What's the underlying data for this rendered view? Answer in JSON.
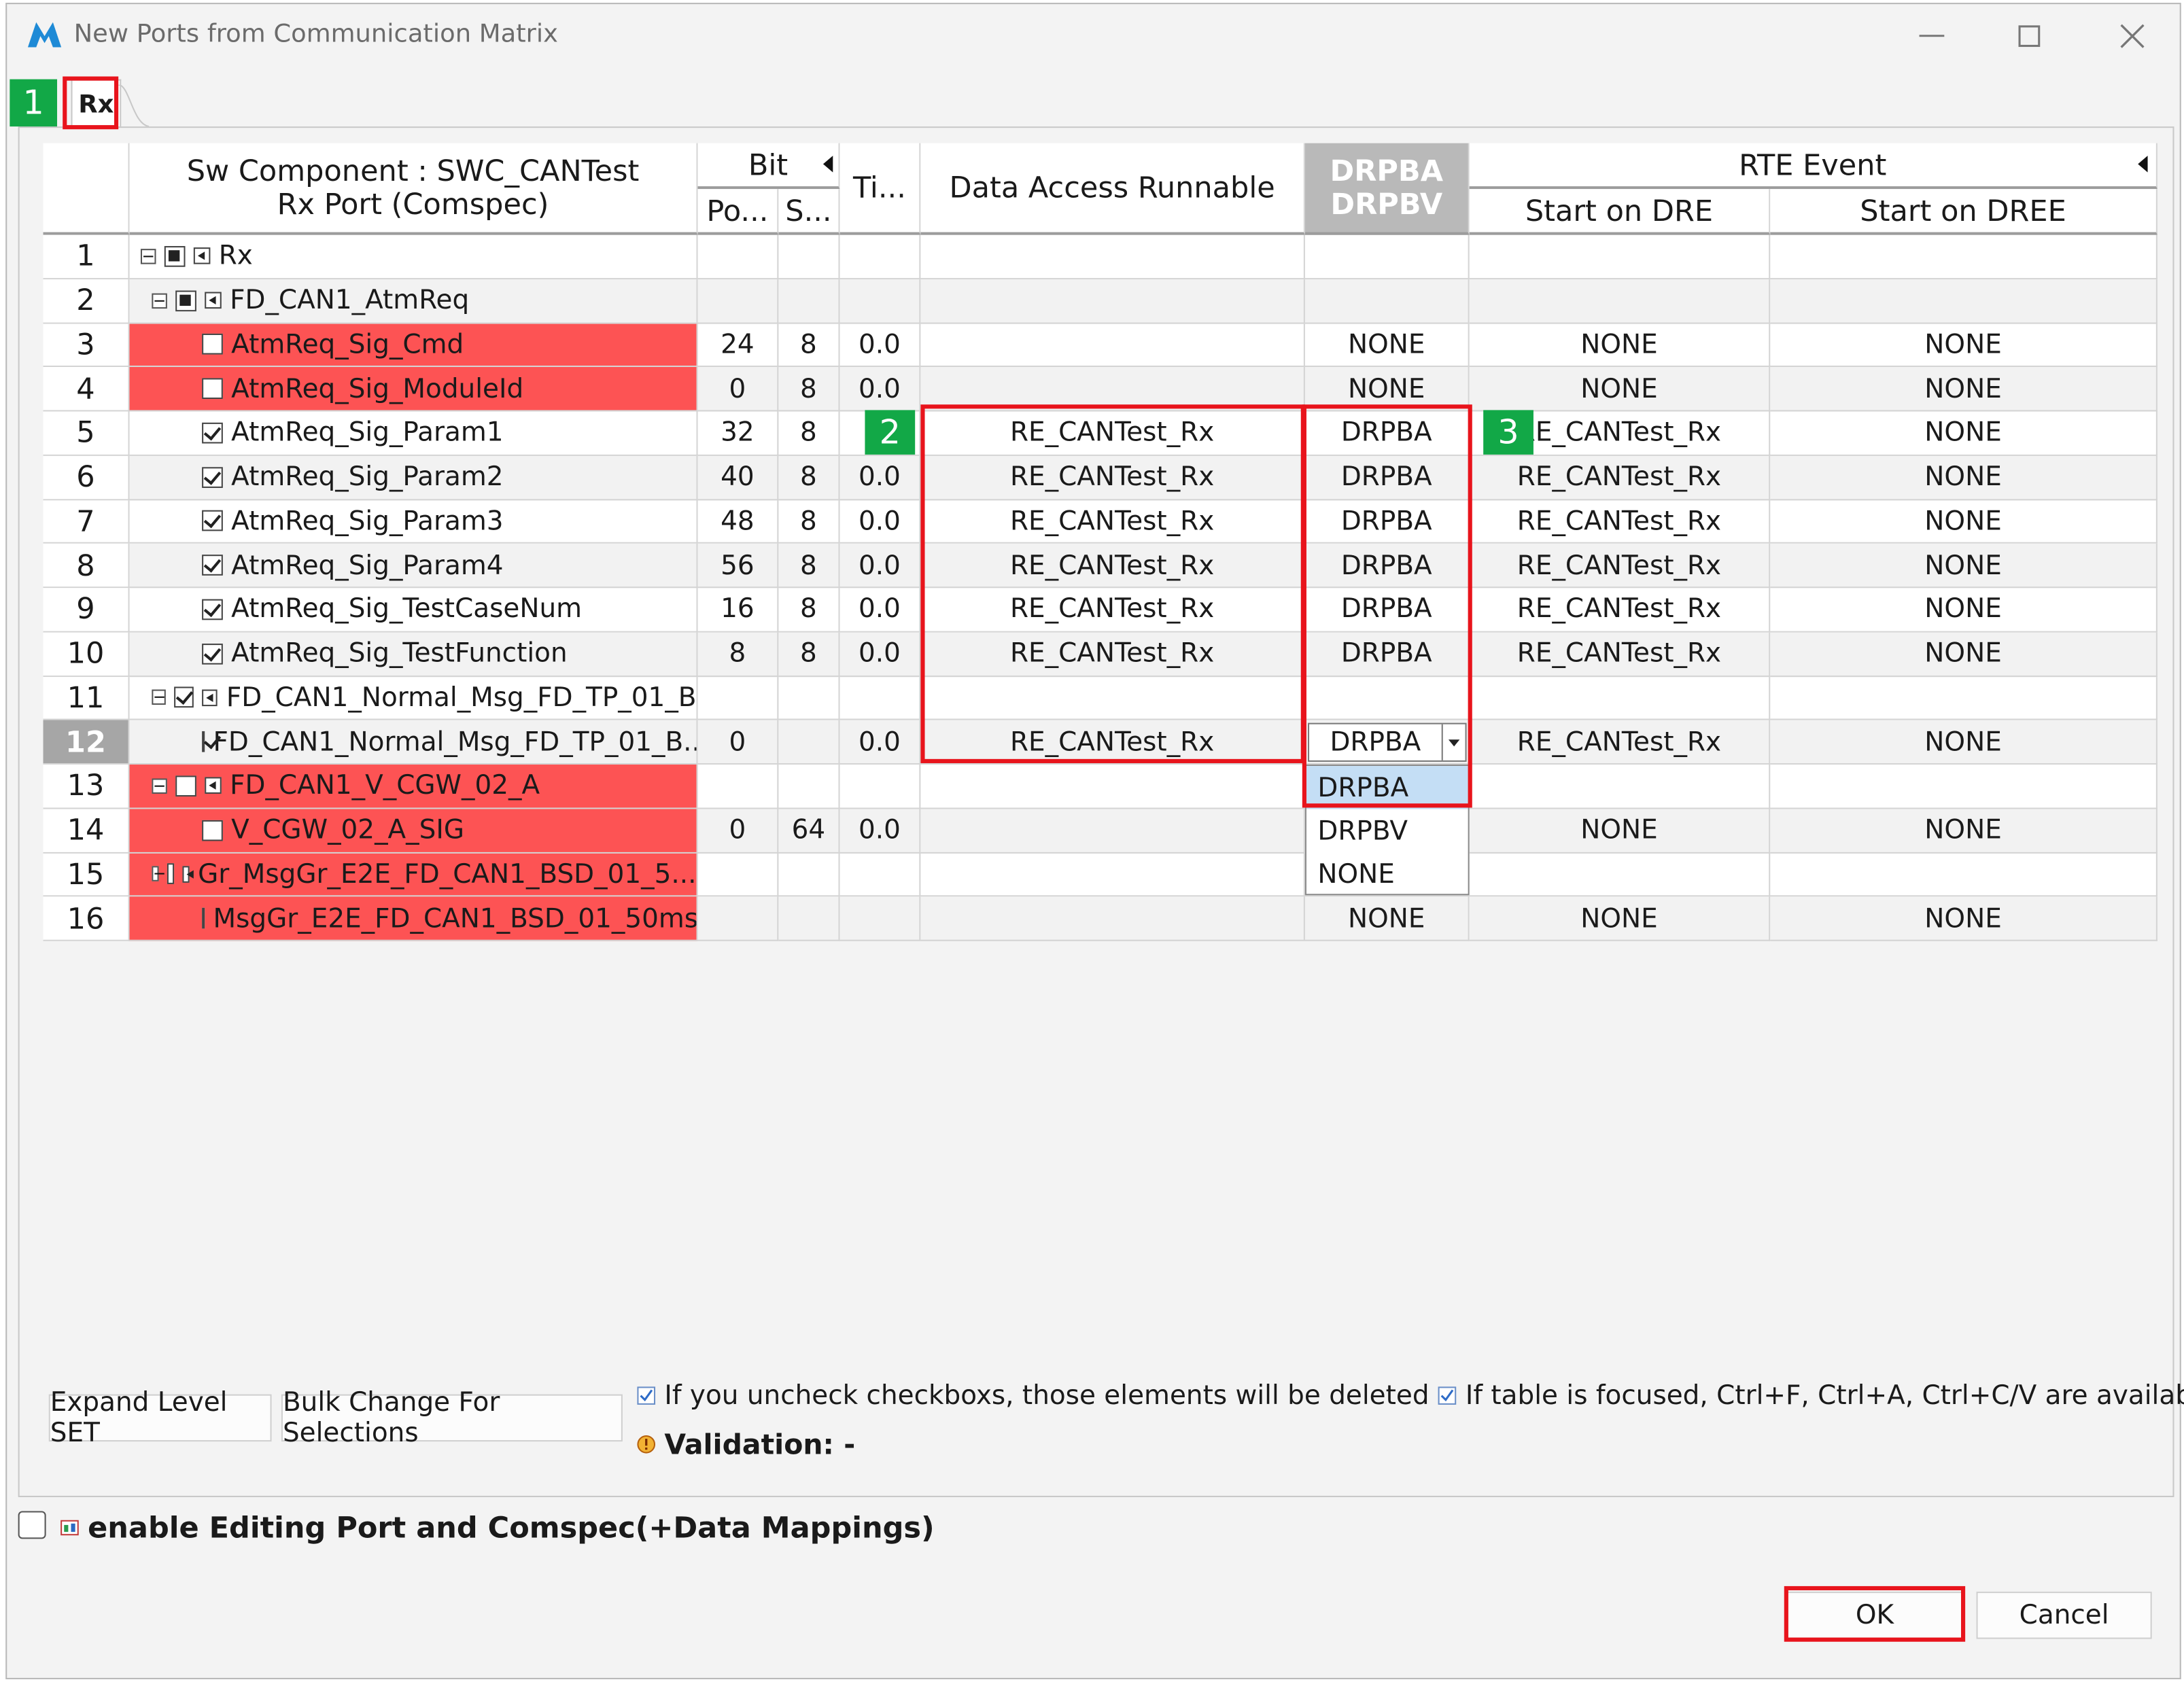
{
  "window": {
    "title": "New Ports from Communication Matrix"
  },
  "tabs": [
    {
      "label": "Rx"
    }
  ],
  "badges": {
    "b1": "1",
    "b2": "2",
    "b3": "3"
  },
  "header": {
    "sw_component_line1": "Sw Component : SWC_CANTest",
    "sw_component_line2": "Rx Port (Comspec)",
    "bit": "Bit",
    "bit_pos": "Po...",
    "bit_size": "S...",
    "timeout": "Ti...",
    "data_access_runnable": "Data Access Runnable",
    "drpba": "DRPBA",
    "drpbv": "DRPBV",
    "rte_event": "RTE Event",
    "start_on_dre": "Start on DRE",
    "start_on_dree": "Start on DREE"
  },
  "rows": [
    {
      "num": "1",
      "name": "Rx",
      "pos": "",
      "size": "",
      "ti": "",
      "dar": "",
      "drp": "",
      "dre": "",
      "dree": ""
    },
    {
      "num": "2",
      "name": "FD_CAN1_AtmReq",
      "pos": "",
      "size": "",
      "ti": "",
      "dar": "",
      "drp": "",
      "dre": "",
      "dree": ""
    },
    {
      "num": "3",
      "name": "AtmReq_Sig_Cmd",
      "pos": "24",
      "size": "8",
      "ti": "0.0",
      "dar": "",
      "drp": "NONE",
      "dre": "NONE",
      "dree": "NONE"
    },
    {
      "num": "4",
      "name": "AtmReq_Sig_ModuleId",
      "pos": "0",
      "size": "8",
      "ti": "0.0",
      "dar": "",
      "drp": "NONE",
      "dre": "NONE",
      "dree": "NONE"
    },
    {
      "num": "5",
      "name": "AtmReq_Sig_Param1",
      "pos": "32",
      "size": "8",
      "ti": "",
      "dar": "RE_CANTest_Rx",
      "drp": "DRPBA",
      "dre": "RE_CANTest_Rx",
      "dree": "NONE"
    },
    {
      "num": "6",
      "name": "AtmReq_Sig_Param2",
      "pos": "40",
      "size": "8",
      "ti": "0.0",
      "dar": "RE_CANTest_Rx",
      "drp": "DRPBA",
      "dre": "RE_CANTest_Rx",
      "dree": "NONE"
    },
    {
      "num": "7",
      "name": "AtmReq_Sig_Param3",
      "pos": "48",
      "size": "8",
      "ti": "0.0",
      "dar": "RE_CANTest_Rx",
      "drp": "DRPBA",
      "dre": "RE_CANTest_Rx",
      "dree": "NONE"
    },
    {
      "num": "8",
      "name": "AtmReq_Sig_Param4",
      "pos": "56",
      "size": "8",
      "ti": "0.0",
      "dar": "RE_CANTest_Rx",
      "drp": "DRPBA",
      "dre": "RE_CANTest_Rx",
      "dree": "NONE"
    },
    {
      "num": "9",
      "name": "AtmReq_Sig_TestCaseNum",
      "pos": "16",
      "size": "8",
      "ti": "0.0",
      "dar": "RE_CANTest_Rx",
      "drp": "DRPBA",
      "dre": "RE_CANTest_Rx",
      "dree": "NONE"
    },
    {
      "num": "10",
      "name": "AtmReq_Sig_TestFunction",
      "pos": "8",
      "size": "8",
      "ti": "0.0",
      "dar": "RE_CANTest_Rx",
      "drp": "DRPBA",
      "dre": "RE_CANTest_Rx",
      "dree": "NONE"
    },
    {
      "num": "11",
      "name": "FD_CAN1_Normal_Msg_FD_TP_01_B",
      "pos": "",
      "size": "",
      "ti": "",
      "dar": "",
      "drp": "",
      "dre": "",
      "dree": ""
    },
    {
      "num": "12",
      "name": "FD_CAN1_Normal_Msg_FD_TP_01_B...",
      "pos": "0",
      "size": "",
      "ti": "0.0",
      "dar": "RE_CANTest_Rx",
      "drp": "DRPBA",
      "dre": "RE_CANTest_Rx",
      "dree": "NONE"
    },
    {
      "num": "13",
      "name": "FD_CAN1_V_CGW_02_A",
      "pos": "",
      "size": "",
      "ti": "",
      "dar": "",
      "drp": "",
      "dre": "",
      "dree": ""
    },
    {
      "num": "14",
      "name": "V_CGW_02_A_SIG",
      "pos": "0",
      "size": "64",
      "ti": "0.0",
      "dar": "",
      "drp": "",
      "dre": "NONE",
      "dree": "NONE"
    },
    {
      "num": "15",
      "name": "Gr_MsgGr_E2E_FD_CAN1_BSD_01_5...",
      "pos": "",
      "size": "",
      "ti": "",
      "dar": "",
      "drp": "",
      "dre": "",
      "dree": ""
    },
    {
      "num": "16",
      "name": "MsgGr_E2E_FD_CAN1_BSD_01_50ms...",
      "pos": "",
      "size": "",
      "ti": "",
      "dar": "",
      "drp": "NONE",
      "dre": "NONE",
      "dree": "NONE"
    }
  ],
  "dropdown": {
    "options": [
      "DRPBA",
      "DRPBV",
      "NONE"
    ],
    "selected": "DRPBA"
  },
  "buttons": {
    "expand_level": "Expand Level SET",
    "bulk_change": "Bulk Change For Selections",
    "ok": "OK",
    "cancel": "Cancel"
  },
  "info": {
    "uncheck_warning": "If you uncheck checkboxs, those elements will be deleted",
    "shortcuts": "If table is focused, Ctrl+F, Ctrl+A, Ctrl+C/V are available.",
    "validation": "Validation: -"
  },
  "enable_editing_label": "enable Editing Port and Comspec(+Data Mappings)",
  "colors": {
    "error_row": "#fd5354",
    "highlight": "#e8141c",
    "badge": "#12a847",
    "dropdown_selected": "#c4def5"
  }
}
